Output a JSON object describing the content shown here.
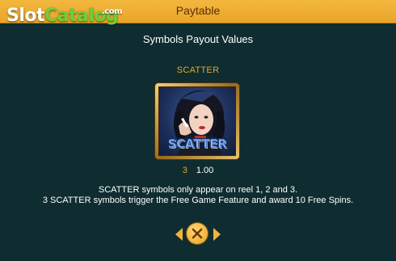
{
  "header": {
    "title": "Paytable"
  },
  "logo": {
    "slot": "Slot",
    "catalog": "Catalog",
    "com": ".com"
  },
  "content": {
    "subtitle": "Symbols Payout Values",
    "symbol": {
      "name": "SCATTER",
      "icon_label": "SCATTER",
      "payouts": [
        {
          "count": "3",
          "value": "1.00"
        }
      ]
    },
    "description": [
      "SCATTER symbols only appear on reel 1, 2 and 3.",
      "3 SCATTER symbols trigger the Free Game Feature and award 10 Free Spins."
    ]
  },
  "colors": {
    "header_bg": "#f3b73f",
    "page_bg": "#0f2d30",
    "accent_gold": "#e6a52b"
  },
  "icons": {
    "prev": "chevron-left-icon",
    "close": "close-icon",
    "next": "chevron-right-icon"
  }
}
